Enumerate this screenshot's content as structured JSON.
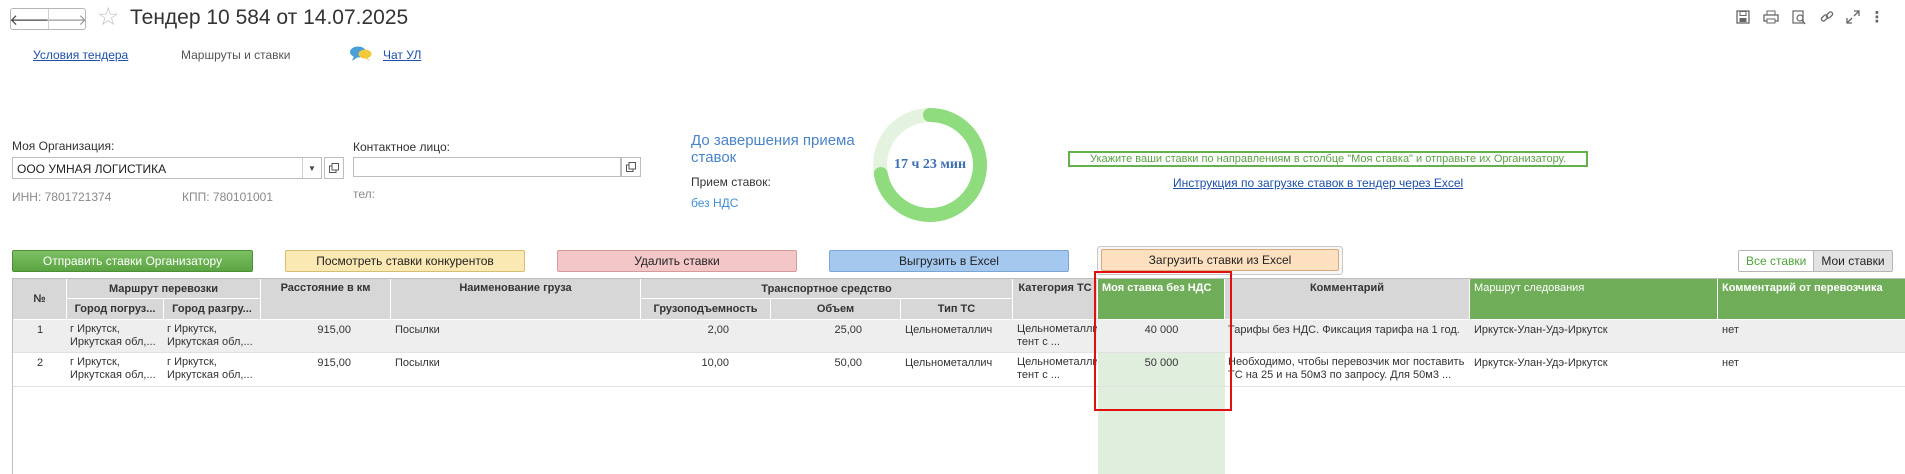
{
  "header": {
    "title": "Тендер 10 584 от 14.07.2025",
    "back_glyph": "🡐",
    "forward_glyph": "🡒",
    "star_glyph": "☆",
    "toolbar_icons": [
      "save-icon",
      "print-icon",
      "preview-icon",
      "link-icon",
      "expand-icon",
      "more-icon"
    ],
    "more_glyph": "⋮"
  },
  "nav": {
    "tender_conditions": "Условия тендера",
    "routes_and_rates": "Маршруты и ставки",
    "chat": "Чат УЛ"
  },
  "form": {
    "org_label": "Моя Организация:",
    "org_value": "ООО УМНАЯ ЛОГИСТИКА",
    "inn": "ИНН: 7801721374",
    "kpp": "КПП: 780101001",
    "contact_label": "Контактное лицо:",
    "contact_value": "",
    "phone_label": "тел:"
  },
  "countdown": {
    "label": "До завершения приема ставок",
    "time": "17 ч 23 мин",
    "accept_label": "Прием ставок:",
    "vat_mode": "без НДС",
    "ring_fraction": 0.72
  },
  "notice": {
    "text": "Укажите ваши ставки по направлениям в столбце \"Моя ставка\" и отправьте их Организатору.",
    "instruction_link": "Инструкция по загрузке ставок в тендер через Excel"
  },
  "actions": {
    "send": "Отправить ставки Организатору",
    "view_competitors": "Посмотреть ставки конкурентов",
    "delete": "Удалить ставки",
    "export": "Выгрузить в Excel",
    "import": "Загрузить ставки из Excel",
    "toggle_all": "Все ставки",
    "toggle_mine": "Мои ставки"
  },
  "table": {
    "headers": {
      "no": "№",
      "route_group": "Маршрут перевозки",
      "city_from": "Город погруз...",
      "city_to": "Город разгру...",
      "distance": "Расстояние в км",
      "cargo": "Наименование груза",
      "vehicle_group": "Транспортное средство",
      "capacity": "Грузоподъемность",
      "volume": "Объем",
      "vehicle_type": "Тип ТС",
      "category": "Категория ТС",
      "my_rate": "Моя ставка без НДС",
      "comment": "Комментарий",
      "route_path": "Маршрут следования",
      "carrier_comment": "Комментарий от перевозчика"
    },
    "rows": [
      {
        "no": "1",
        "city_from": "г Иркутск, Иркутская обл,...",
        "city_to": "г Иркутск, Иркутская обл,...",
        "distance": "915,00",
        "cargo": "Посылки",
        "capacity": "2,00",
        "volume": "25,00",
        "vehicle_type": "Цельнометаллич",
        "category": "Цельнометаллич тент с ...",
        "my_rate": "40 000",
        "comment": "Тарифы без НДС. Фиксация тарифа на 1 год.",
        "route_path": "Иркутск-Улан-Удэ-Иркутск",
        "carrier_comment": "нет"
      },
      {
        "no": "2",
        "city_from": "г Иркутск, Иркутская обл,...",
        "city_to": "г Иркутск, Иркутская обл,...",
        "distance": "915,00",
        "cargo": "Посылки",
        "capacity": "10,00",
        "volume": "50,00",
        "vehicle_type": "Цельнометаллич",
        "category": "Цельнометаллич тент с ...",
        "my_rate": "50 000",
        "comment": "Необходимо, чтобы перевозчик мог поставить ТС на 25 и на 50м3 по запросу. Для 50м3 ...",
        "route_path": "Иркутск-Улан-Удэ-Иркутск",
        "carrier_comment": "нет"
      }
    ]
  },
  "colors": {
    "accent_green": "#6fad58",
    "ring_green": "#8fdc7f",
    "highlight_red": "#e01010",
    "link_blue": "#1f4fa8"
  }
}
